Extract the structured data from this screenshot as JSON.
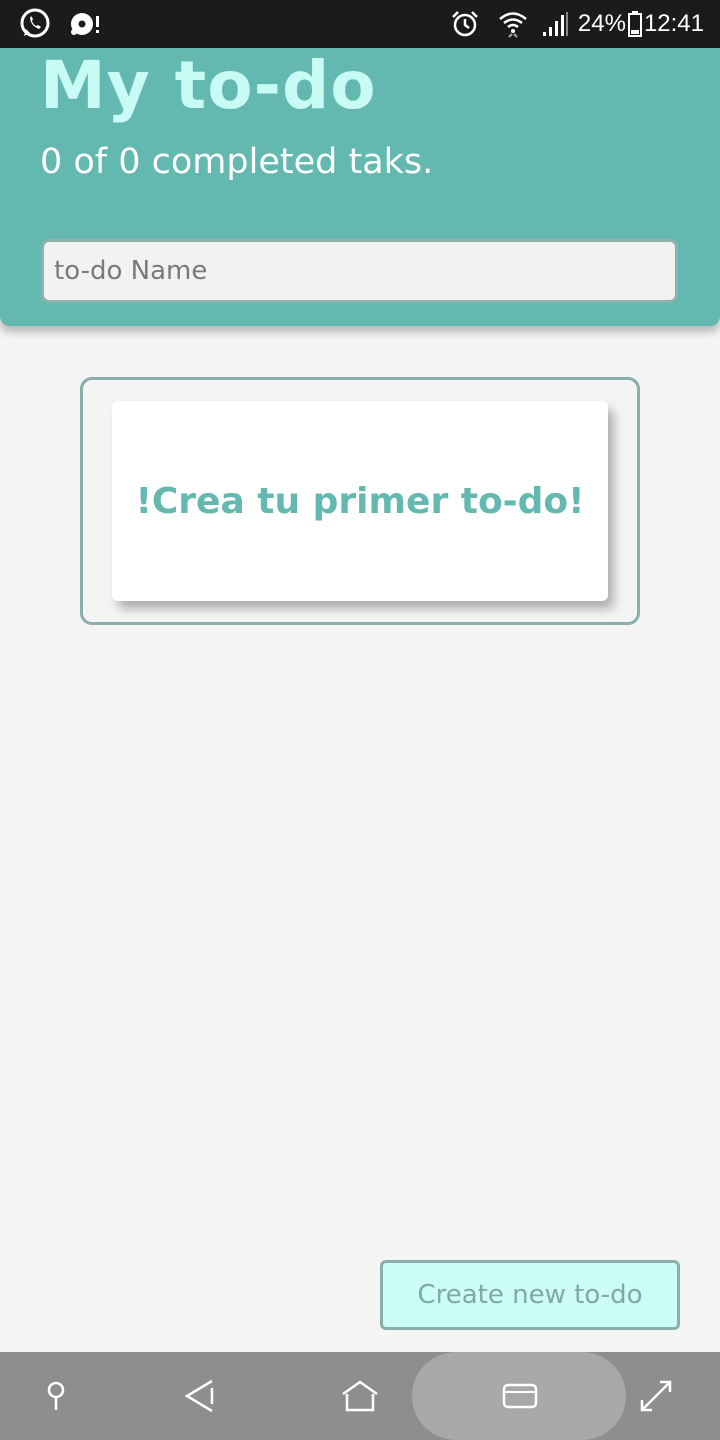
{
  "status_bar": {
    "icons_left": [
      "whatsapp-icon",
      "media-icon"
    ],
    "icons_right": [
      "alarm-icon",
      "wifi-icon",
      "signal-icon"
    ],
    "battery": "24%",
    "time": "12:41"
  },
  "header": {
    "title": "My to-do",
    "subtitle": "0 of 0 completed taks.",
    "input_placeholder": "to-do Name",
    "input_value": ""
  },
  "empty_state": {
    "message": "!Crea tu primer to-do!"
  },
  "create_button": {
    "label": "Create new to-do"
  },
  "nav_bar": {
    "icons": [
      "pin-icon",
      "back-icon",
      "home-icon",
      "recents-icon",
      "expand-icon"
    ]
  },
  "colors": {
    "header_bg": "#63b9b0",
    "title": "#c8fbf3",
    "accent": "#63b9b0",
    "button_bg": "#ccfdf6",
    "border": "#89aeab"
  }
}
